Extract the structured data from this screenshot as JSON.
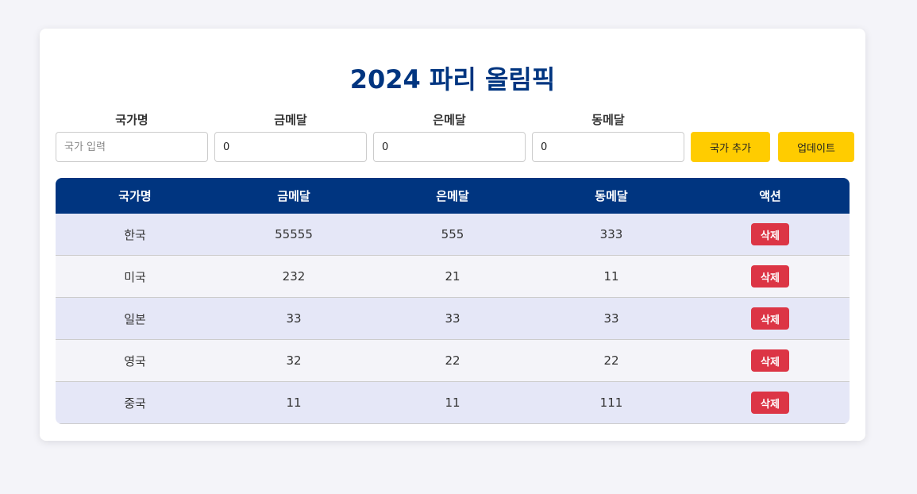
{
  "page": {
    "title": "2024 파리 올림픽"
  },
  "form": {
    "country": {
      "label": "국가명",
      "placeholder": "국가 입력",
      "value": ""
    },
    "gold": {
      "label": "금메달",
      "value": "0"
    },
    "silver": {
      "label": "은메달",
      "value": "0"
    },
    "bronze": {
      "label": "동메달",
      "value": "0"
    },
    "add_label": "국가 추가",
    "update_label": "업데이트"
  },
  "table": {
    "headers": [
      "국가명",
      "금메달",
      "은메달",
      "동메달",
      "액션"
    ],
    "delete_label": "삭제",
    "rows": [
      {
        "country": "한국",
        "gold": "55555",
        "silver": "555",
        "bronze": "333"
      },
      {
        "country": "미국",
        "gold": "232",
        "silver": "21",
        "bronze": "11"
      },
      {
        "country": "일본",
        "gold": "33",
        "silver": "33",
        "bronze": "33"
      },
      {
        "country": "영국",
        "gold": "32",
        "silver": "22",
        "bronze": "22"
      },
      {
        "country": "중국",
        "gold": "11",
        "silver": "11",
        "bronze": "111"
      }
    ]
  },
  "colors": {
    "primary": "#003580",
    "accent": "#ffcc00",
    "danger": "#dc3545",
    "row_odd": "#e5e7f7",
    "row_even": "#f4f4f9",
    "background": "#f4f4f9"
  }
}
